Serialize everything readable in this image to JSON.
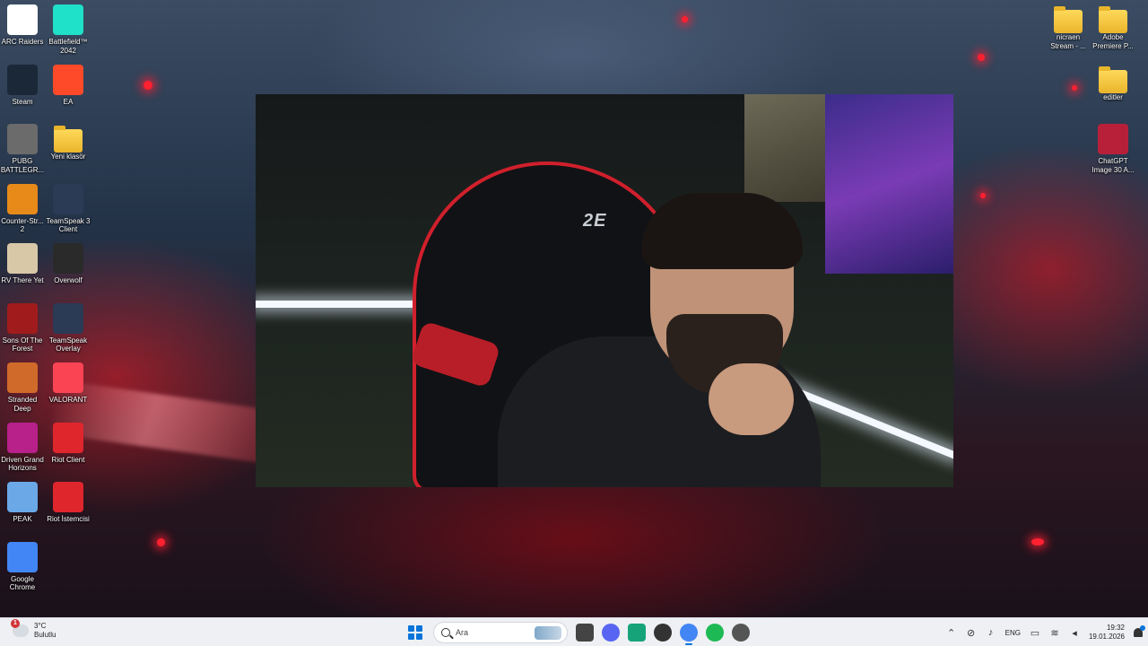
{
  "desktop": {
    "icons_left": [
      {
        "label": "ARC Raiders",
        "icon": "arc-raiders-icon",
        "color": "#ffffff"
      },
      {
        "label": "Battlefield™\n2042",
        "icon": "battlefield-icon",
        "color": "#1fe0c8"
      },
      {
        "label": "Steam",
        "icon": "steam-icon",
        "color": "#1b2838"
      },
      {
        "label": "EA",
        "icon": "ea-icon",
        "color": "#ff4a2a"
      },
      {
        "label": "PUBG\nBATTLEGR...",
        "icon": "pubg-icon",
        "color": "#6b6b6b"
      },
      {
        "label": "Yeni klasör",
        "icon": "folder-icon",
        "color": "#f5c644"
      },
      {
        "label": "Counter-Str...\n2",
        "icon": "counter-strike-icon",
        "color": "#e88a1a"
      },
      {
        "label": "TeamSpeak 3\nClient",
        "icon": "teamspeak-icon",
        "color": "#2b3a55"
      },
      {
        "label": "RV There Yet",
        "icon": "rv-there-yet-icon",
        "color": "#d8c8a8"
      },
      {
        "label": "Overwolf",
        "icon": "overwolf-icon",
        "color": "#2a2a2a"
      },
      {
        "label": "Sons Of The\nForest",
        "icon": "sons-of-the-forest-icon",
        "color": "#a01c1c"
      },
      {
        "label": "TeamSpeak\nOverlay",
        "icon": "teamspeak-overlay-icon",
        "color": "#2b3a55"
      },
      {
        "label": "Stranded\nDeep",
        "icon": "stranded-deep-icon",
        "color": "#d06a2a"
      },
      {
        "label": "VALORANT",
        "icon": "valorant-icon",
        "color": "#fa4454"
      },
      {
        "label": "Driven Grand\nHorizons",
        "icon": "driven-grand-horizons-icon",
        "color": "#b8208a"
      },
      {
        "label": "Riot Client",
        "icon": "riot-client-icon",
        "color": "#e0262d"
      },
      {
        "label": "PEAK",
        "icon": "peak-icon",
        "color": "#6aa8e8"
      },
      {
        "label": "Riot İstemcisi",
        "icon": "riot-istemcisi-icon",
        "color": "#e0262d"
      },
      {
        "label": "Google\nChrome",
        "icon": "chrome-icon",
        "color": "#4285f4"
      }
    ],
    "icons_right": [
      {
        "label": "nicraen\nStream - ...",
        "icon": "folder-icon",
        "color": "#f5c644"
      },
      {
        "label": "Adobe\nPremiere P...",
        "icon": "folder-icon",
        "color": "#f5c644"
      },
      {
        "label": "editler",
        "icon": "folder-icon",
        "color": "#f5c644"
      },
      {
        "label": "ChatGPT\nImage 30 A...",
        "icon": "image-file-icon",
        "color": "#b8203a"
      }
    ]
  },
  "webcam": {
    "chair_brand": "2E",
    "accent": "#d0202c"
  },
  "taskbar": {
    "weather": {
      "temp": "3°C",
      "condition": "Bulutlu",
      "badge": "1"
    },
    "search_placeholder": "Ara",
    "apps": [
      {
        "name": "file-explorer-icon",
        "color": "#444"
      },
      {
        "name": "discord-icon",
        "color": "#5865f2"
      },
      {
        "name": "app-green-icon",
        "color": "#16a37a"
      },
      {
        "name": "app-dark-icon",
        "color": "#333"
      },
      {
        "name": "chrome-icon",
        "color": "#4285f4"
      },
      {
        "name": "spotify-icon",
        "color": "#1db954"
      },
      {
        "name": "app-gear-icon",
        "color": "#555"
      }
    ],
    "tray": {
      "language": "ENG",
      "time": "19:32",
      "date": "19.01.2026"
    }
  }
}
